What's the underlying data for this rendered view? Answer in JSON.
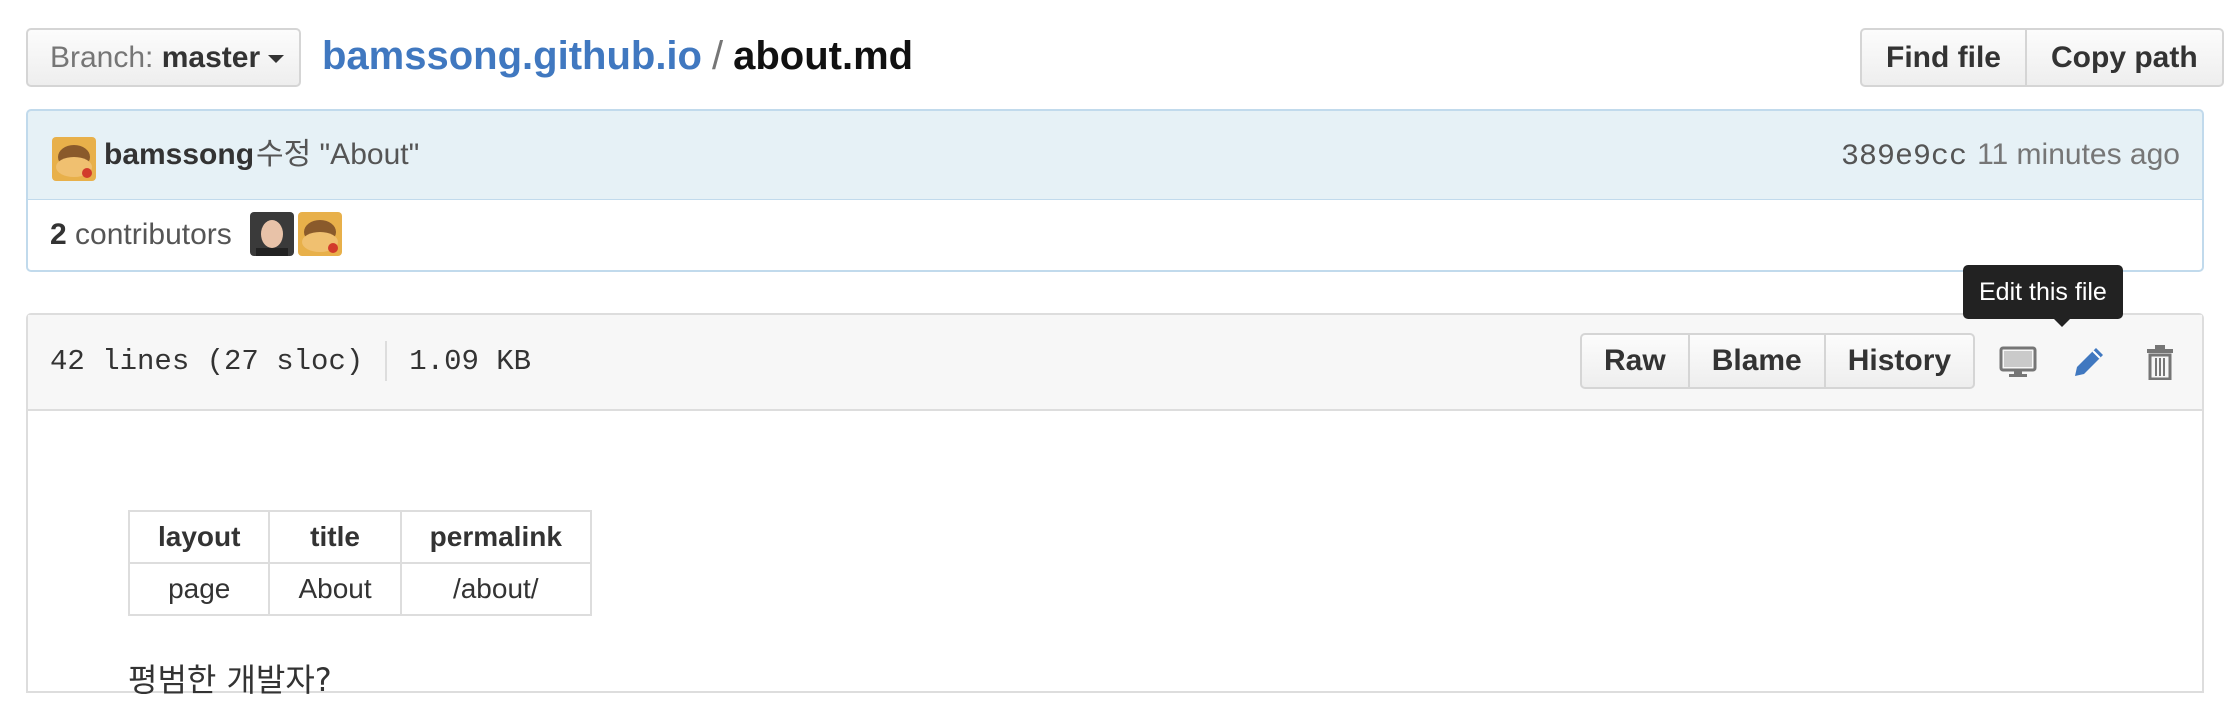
{
  "branch": {
    "prefix": "Branch:",
    "name": "master"
  },
  "breadcrumb": {
    "repo": "bamssong.github.io",
    "separator": "/",
    "file": "about.md"
  },
  "header_actions": {
    "find_file": "Find file",
    "copy_path": "Copy path"
  },
  "commit": {
    "author": "bamssong",
    "message": "수정 \"About\"",
    "sha": "389e9cc",
    "time": "11 minutes ago"
  },
  "contributors": {
    "count": "2",
    "label": "contributors"
  },
  "file": {
    "lines": "42 lines (27 sloc)",
    "size": "1.09 KB",
    "actions": {
      "raw": "Raw",
      "blame": "Blame",
      "history": "History"
    },
    "icons": [
      "desktop-icon",
      "pencil-icon",
      "trash-icon"
    ],
    "tooltip": "Edit this file"
  },
  "markdown": {
    "table": {
      "headers": [
        "layout",
        "title",
        "permalink"
      ],
      "rows": [
        [
          "page",
          "About",
          "/about/"
        ]
      ]
    },
    "paragraph": "평범한 개발자?"
  },
  "colors": {
    "link": "#4078c0",
    "commit_bg": "#e6f1f6",
    "edit_icon": "#4078c0"
  }
}
